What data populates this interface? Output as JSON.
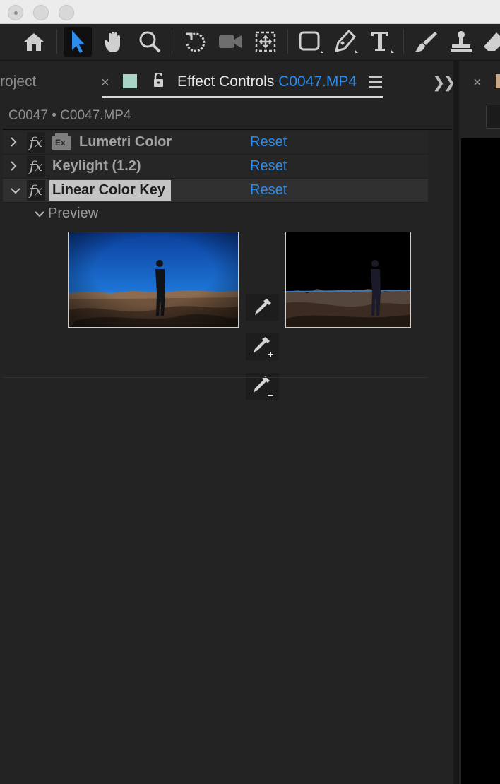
{
  "window": {
    "controls": [
      "close",
      "minimize",
      "maximize"
    ]
  },
  "toolbar": {
    "tools": [
      "home-icon",
      "selection-arrow-icon",
      "hand-icon",
      "zoom-icon",
      "rotation-icon",
      "camera-icon",
      "pan-behind-icon",
      "shape-rectangle-icon",
      "pen-icon",
      "type-icon",
      "brush-icon",
      "clone-stamp-icon",
      "eraser-icon"
    ],
    "active_tool": "selection-arrow-icon",
    "accent_color": "#2d8ceb"
  },
  "panel": {
    "project_tab": "roject",
    "effect_controls_tab": {
      "label": "Effect Controls",
      "file": "C0047.MP4"
    },
    "label_color": "#a8d5c8",
    "breadcrumb": "C0047 • C0047.MP4"
  },
  "effects": [
    {
      "name": "Lumetri Color",
      "reset": "Reset",
      "expanded": false
    },
    {
      "name": "Keylight (1.2)",
      "reset": "Reset",
      "expanded": false
    },
    {
      "name": "Linear Color Key",
      "reset": "Reset",
      "expanded": true
    }
  ],
  "preview": {
    "label": "Preview",
    "eyedroppers": [
      "key-eyedropper-icon",
      "add-eyedropper-icon",
      "subtract-eyedropper-icon"
    ]
  },
  "right_panel": {
    "label_color": "#c7a98a"
  }
}
